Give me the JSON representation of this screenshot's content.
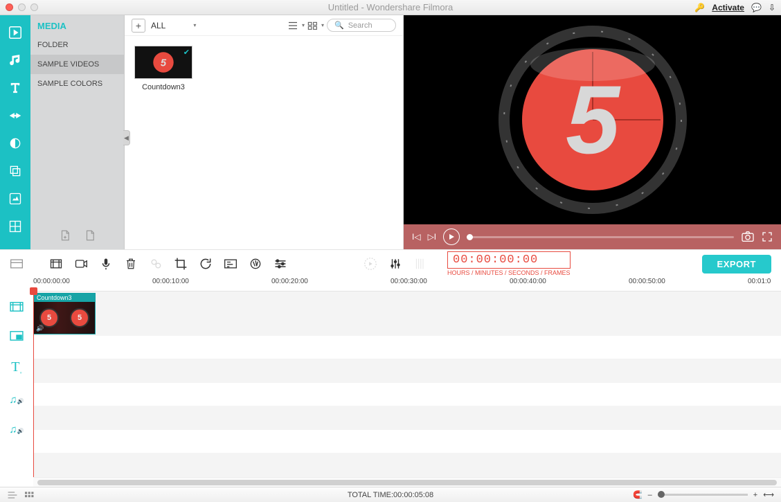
{
  "title": "Untitled - Wondershare Filmora",
  "activate": "Activate",
  "media": {
    "header": "MEDIA",
    "items": [
      "FOLDER",
      "SAMPLE VIDEOS",
      "SAMPLE COLORS"
    ],
    "active_index": 1
  },
  "browser": {
    "filter": "ALL",
    "search_placeholder": "Search",
    "thumb_label": "Countdown3"
  },
  "timecode": {
    "value": "00:00:00:00",
    "caption": "HOURS / MINUTES / SECONDS / FRAMES"
  },
  "export_label": "EXPORT",
  "ruler": [
    "00:00:00:00",
    "00:00:10:00",
    "00:00:20:00",
    "00:00:30:00",
    "00:00:40:00",
    "00:00:50:00",
    "00:01:0"
  ],
  "clip_name": "Countdown3",
  "status": {
    "total_time": "TOTAL TIME:00:00:05:08"
  },
  "preview_number": "5"
}
